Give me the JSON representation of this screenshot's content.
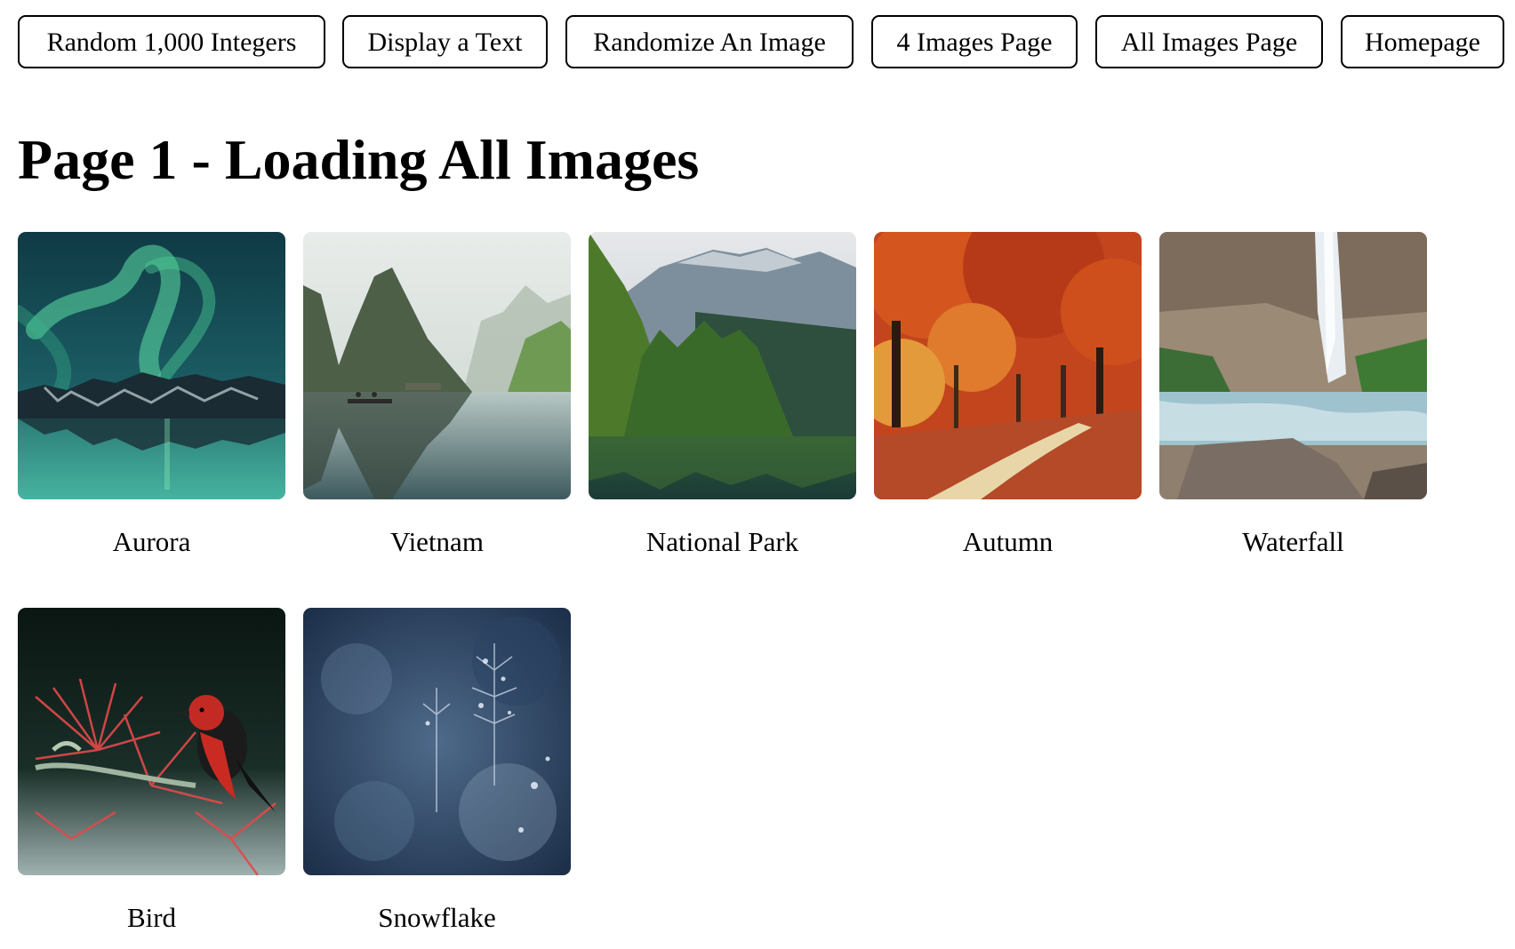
{
  "nav": {
    "buttons": [
      {
        "label": "Random 1,000 Integers"
      },
      {
        "label": "Display a Text"
      },
      {
        "label": "Randomize An Image"
      },
      {
        "label": "4 Images Page"
      },
      {
        "label": "All Images Page"
      },
      {
        "label": "Homepage"
      }
    ]
  },
  "page": {
    "title": "Page 1 - Loading All Images"
  },
  "gallery": {
    "items": [
      {
        "caption": "Aurora"
      },
      {
        "caption": "Vietnam"
      },
      {
        "caption": "National Park"
      },
      {
        "caption": "Autumn"
      },
      {
        "caption": "Waterfall"
      },
      {
        "caption": "Bird"
      },
      {
        "caption": "Snowflake"
      }
    ]
  }
}
